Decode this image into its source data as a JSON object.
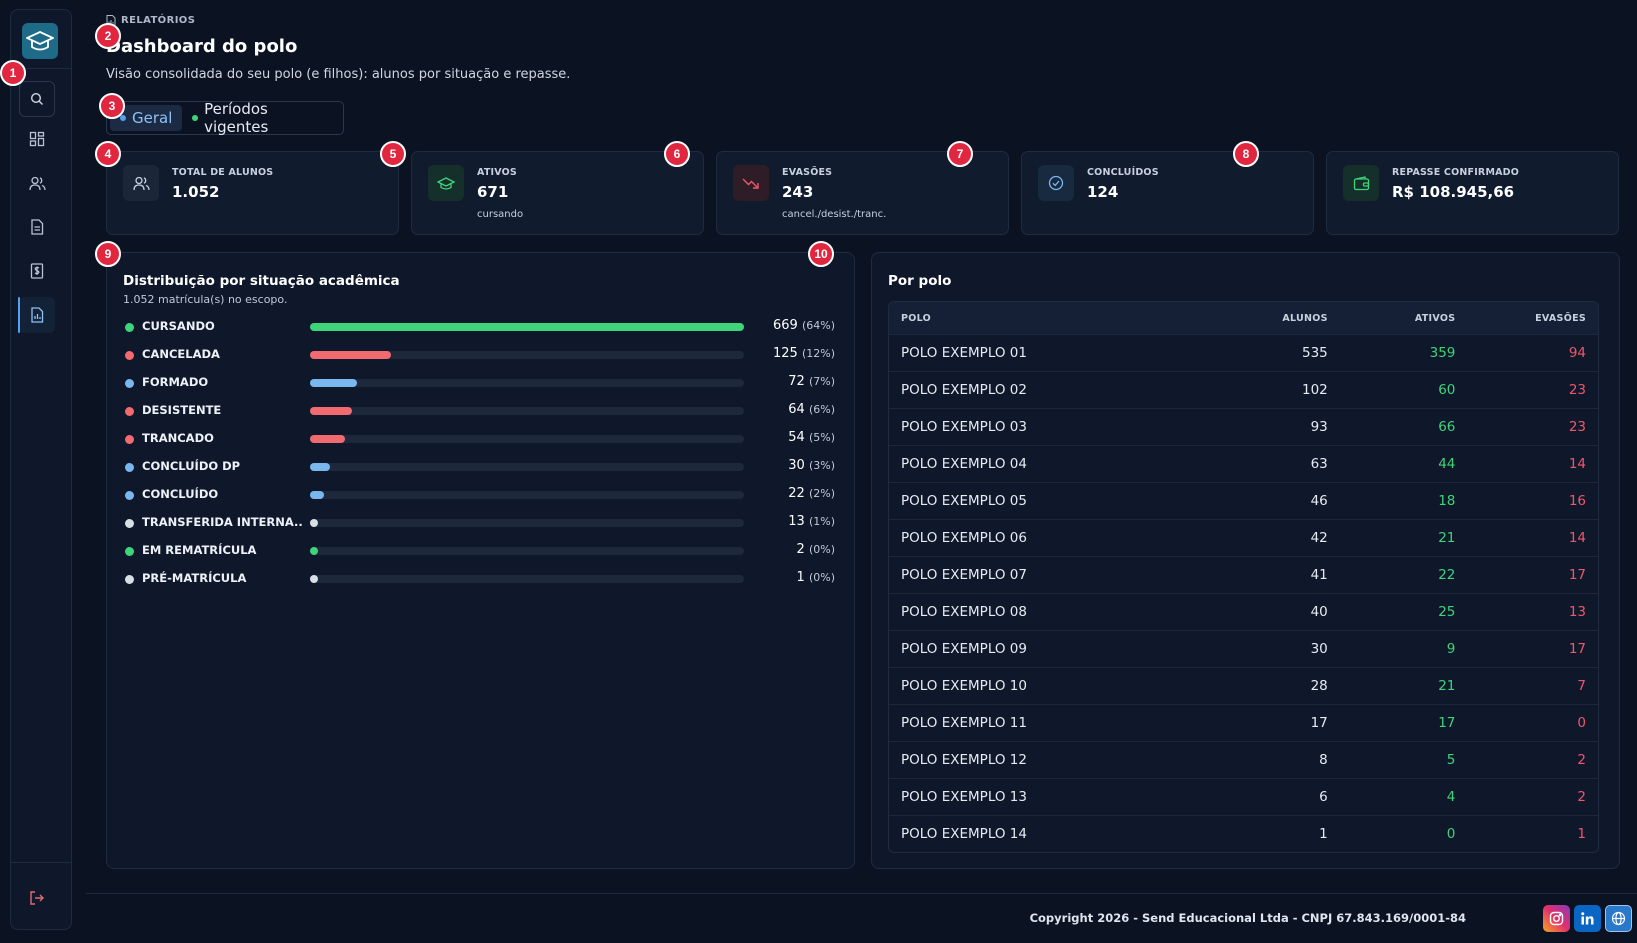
{
  "breadcrumb": "RELATÓRIOS",
  "title": "Dashboard do polo",
  "subtitle": "Visão consolidada do seu polo (e filhos): alunos por situação e repasse.",
  "tabs": [
    {
      "label": "Geral",
      "dot": "#4fa3f0"
    },
    {
      "label": "Períodos vigentes",
      "dot": "#3fd47a"
    }
  ],
  "kpis": [
    {
      "label": "TOTAL DE ALUNOS",
      "value": "1.052",
      "sub": "",
      "icon": "users-icon"
    },
    {
      "label": "ATIVOS",
      "value": "671",
      "sub": "cursando",
      "icon": "graduation-cap-icon"
    },
    {
      "label": "EVASÕES",
      "value": "243",
      "sub": "cancel./desist./tranc.",
      "icon": "trending-down-icon"
    },
    {
      "label": "CONCLUÍDOS",
      "value": "124",
      "sub": "",
      "icon": "check-circle-icon"
    },
    {
      "label": "REPASSE CONFIRMADO",
      "value": "R$ 108.945,66",
      "sub": "",
      "icon": "wallet-icon"
    }
  ],
  "distribution": {
    "title": "Distribuição por situação acadêmica",
    "subtitle": "1.052 matrícula(s) no escopo.",
    "items": [
      {
        "label": "CURSANDO",
        "value": "669",
        "pct": "(64%)",
        "fraction": 1.0,
        "color": "#3fd47a"
      },
      {
        "label": "CANCELADA",
        "value": "125",
        "pct": "(12%)",
        "fraction": 0.187,
        "color": "#f06a6f"
      },
      {
        "label": "FORMADO",
        "value": "72",
        "pct": "(7%)",
        "fraction": 0.108,
        "color": "#7ab7ee"
      },
      {
        "label": "DESISTENTE",
        "value": "64",
        "pct": "(6%)",
        "fraction": 0.096,
        "color": "#f06a6f"
      },
      {
        "label": "TRANCADO",
        "value": "54",
        "pct": "(5%)",
        "fraction": 0.081,
        "color": "#f06a6f"
      },
      {
        "label": "CONCLUÍDO DP",
        "value": "30",
        "pct": "(3%)",
        "fraction": 0.045,
        "color": "#7ab7ee"
      },
      {
        "label": "CONCLUÍDO",
        "value": "22",
        "pct": "(2%)",
        "fraction": 0.033,
        "color": "#7ab7ee"
      },
      {
        "label": "TRANSFERIDA INTERNA...",
        "value": "13",
        "pct": "(1%)",
        "fraction": 0.019,
        "color": "#d9dee6"
      },
      {
        "label": "EM REMATRÍCULA",
        "value": "2",
        "pct": "(0%)",
        "fraction": 0.003,
        "color": "#3fd47a"
      },
      {
        "label": "PRÉ-MATRÍCULA",
        "value": "1",
        "pct": "(0%)",
        "fraction": 0.0015,
        "color": "#d9dee6"
      }
    ]
  },
  "por_polo": {
    "title": "Por polo",
    "columns": [
      "POLO",
      "ALUNOS",
      "ATIVOS",
      "EVASÕES"
    ],
    "rows": [
      [
        "POLO EXEMPLO 01",
        "535",
        "359",
        "94"
      ],
      [
        "POLO EXEMPLO 02",
        "102",
        "60",
        "23"
      ],
      [
        "POLO EXEMPLO 03",
        "93",
        "66",
        "23"
      ],
      [
        "POLO EXEMPLO 04",
        "63",
        "44",
        "14"
      ],
      [
        "POLO EXEMPLO 05",
        "46",
        "18",
        "16"
      ],
      [
        "POLO EXEMPLO 06",
        "42",
        "21",
        "14"
      ],
      [
        "POLO EXEMPLO 07",
        "41",
        "22",
        "17"
      ],
      [
        "POLO EXEMPLO 08",
        "40",
        "25",
        "13"
      ],
      [
        "POLO EXEMPLO 09",
        "30",
        "9",
        "17"
      ],
      [
        "POLO EXEMPLO 10",
        "28",
        "21",
        "7"
      ],
      [
        "POLO EXEMPLO 11",
        "17",
        "17",
        "0"
      ],
      [
        "POLO EXEMPLO 12",
        "8",
        "5",
        "2"
      ],
      [
        "POLO EXEMPLO 13",
        "6",
        "4",
        "2"
      ],
      [
        "POLO EXEMPLO 14",
        "1",
        "0",
        "1"
      ]
    ]
  },
  "badges": [
    "1",
    "2",
    "3",
    "4",
    "5",
    "6",
    "7",
    "8",
    "9",
    "10"
  ],
  "footer": {
    "copyright": "Copyright 2026 - Send Educacional Ltda - CNPJ 67.843.169/0001-84",
    "social": [
      "instagram-icon",
      "linkedin-icon",
      "globe-icon"
    ]
  },
  "colors": {
    "accent": "#4fa3f0",
    "success": "#3fd47a",
    "danger": "#f0566a",
    "badge": "#e0273f"
  }
}
